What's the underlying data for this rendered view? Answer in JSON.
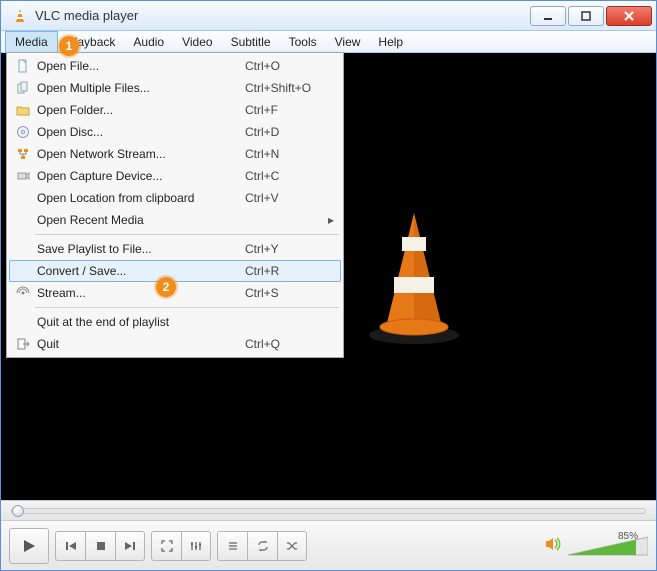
{
  "window": {
    "title": "VLC media player"
  },
  "menubar": {
    "items": [
      "Media",
      "Playback",
      "Audio",
      "Video",
      "Subtitle",
      "Tools",
      "View",
      "Help"
    ],
    "open_index": 0
  },
  "annotations": {
    "badge1": "1",
    "badge2": "2"
  },
  "dropdown": {
    "items": [
      {
        "icon": "file-icon",
        "label": "Open File...",
        "shortcut": "Ctrl+O"
      },
      {
        "icon": "files-icon",
        "label": "Open Multiple Files...",
        "shortcut": "Ctrl+Shift+O"
      },
      {
        "icon": "folder-icon",
        "label": "Open Folder...",
        "shortcut": "Ctrl+F"
      },
      {
        "icon": "disc-icon",
        "label": "Open Disc...",
        "shortcut": "Ctrl+D"
      },
      {
        "icon": "network-icon",
        "label": "Open Network Stream...",
        "shortcut": "Ctrl+N"
      },
      {
        "icon": "capture-icon",
        "label": "Open Capture Device...",
        "shortcut": "Ctrl+C"
      },
      {
        "icon": "",
        "label": "Open Location from clipboard",
        "shortcut": "Ctrl+V"
      },
      {
        "icon": "",
        "label": "Open Recent Media",
        "shortcut": "",
        "submenu": true
      },
      {
        "sep": true
      },
      {
        "icon": "",
        "label": "Save Playlist to File...",
        "shortcut": "Ctrl+Y"
      },
      {
        "icon": "",
        "label": "Convert / Save...",
        "shortcut": "Ctrl+R",
        "hover": true,
        "badge": "2"
      },
      {
        "icon": "stream-icon",
        "label": "Stream...",
        "shortcut": "Ctrl+S"
      },
      {
        "sep": true
      },
      {
        "icon": "",
        "label": "Quit at the end of playlist",
        "shortcut": ""
      },
      {
        "icon": "quit-icon",
        "label": "Quit",
        "shortcut": "Ctrl+Q"
      }
    ]
  },
  "volume": {
    "label": "85%",
    "level": 0.85
  }
}
